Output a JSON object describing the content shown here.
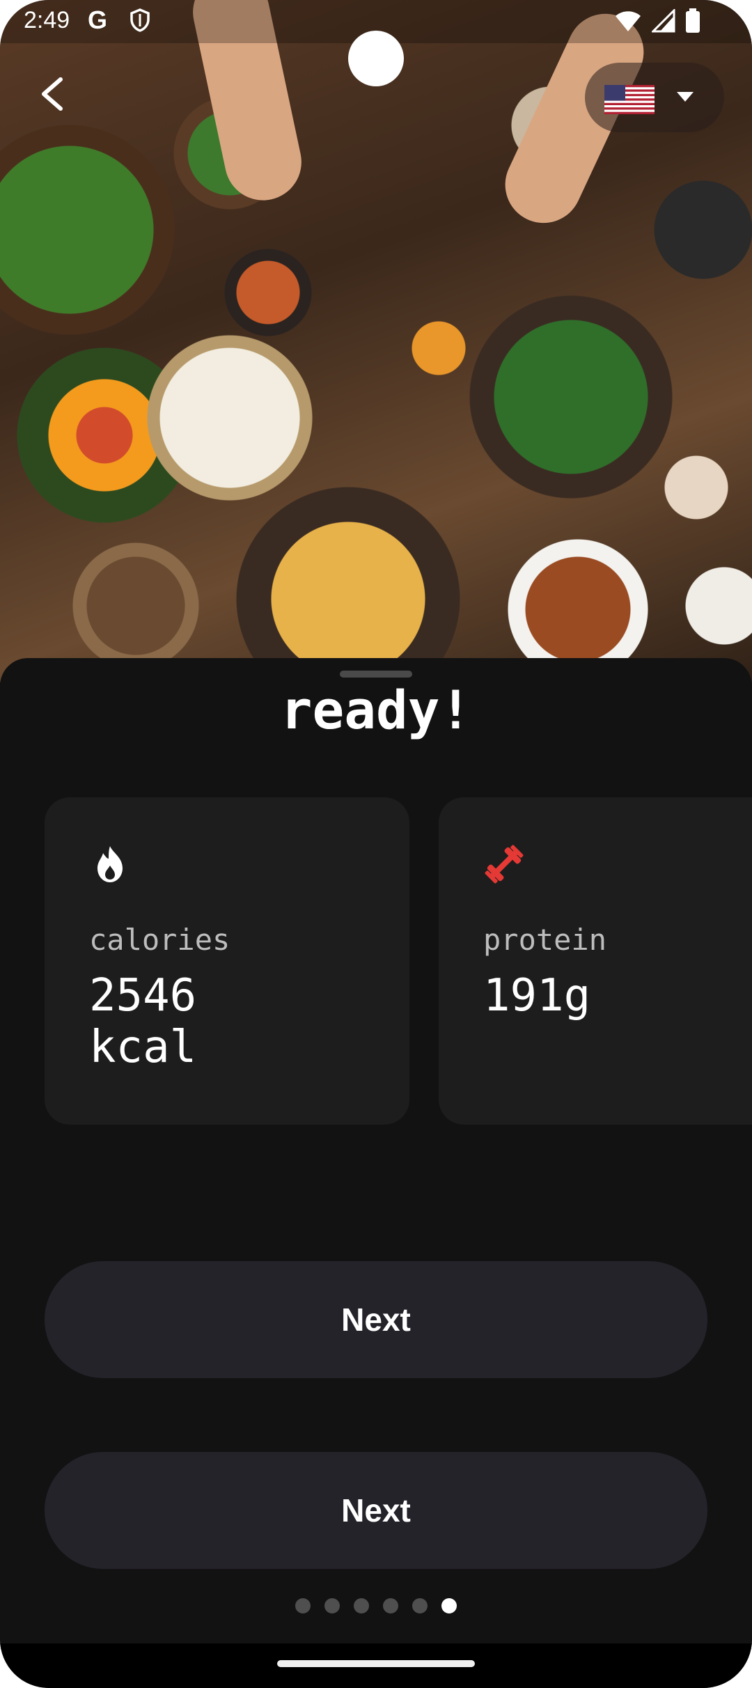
{
  "status_bar": {
    "time": "2:49",
    "google_icon": "G",
    "shield_icon": "shield-icon",
    "wifi_icon": "wifi-icon",
    "signal_icon": "signal-icon",
    "battery_icon": "battery-icon"
  },
  "header": {
    "back_icon": "back-arrow-icon",
    "language_flag": "us-flag-icon",
    "language_caret": "caret-down-icon"
  },
  "sheet": {
    "headline": "ready!",
    "cards": [
      {
        "icon": "flame-icon",
        "label": "calories",
        "value": "2546\nkcal"
      },
      {
        "icon": "dumbbell-icon",
        "label": "protein",
        "value": "191g"
      }
    ],
    "buttons": [
      {
        "label": "Next"
      },
      {
        "label": "Next"
      }
    ],
    "pager": {
      "total": 6,
      "active_index": 5
    }
  },
  "colors": {
    "background": "#121212",
    "card": "#1d1d1d",
    "button": "#25232a",
    "protein_accent": "#e53935",
    "text": "#ffffff"
  }
}
